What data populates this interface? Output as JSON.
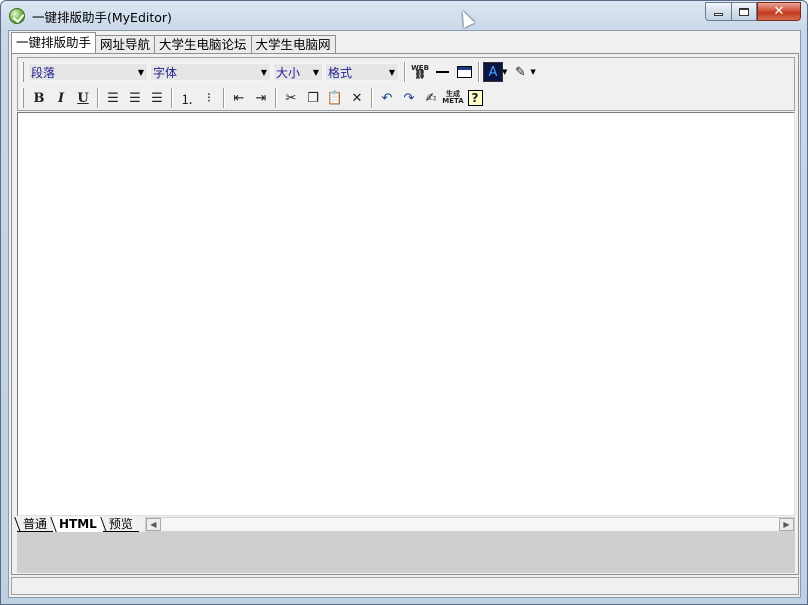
{
  "window": {
    "title": "一键排版助手(MyEditor)",
    "close_color": "#c13920"
  },
  "tabs": [
    {
      "label": "一键排版助手",
      "active": true
    },
    {
      "label": "网址导航",
      "active": false
    },
    {
      "label": "大学生电脑论坛",
      "active": false
    },
    {
      "label": "大学生电脑网",
      "active": false
    }
  ],
  "toolbar": {
    "paragraph_combo": "段落",
    "font_combo": "字体",
    "size_combo": "大小",
    "style_combo": "格式",
    "web_icon_label": "WEB",
    "bold_label": "B",
    "italic_label": "I",
    "underline_label": "U",
    "meta_label": "生成 META"
  },
  "mode_tabs": [
    {
      "label": "普通",
      "active": false
    },
    {
      "label": "HTML",
      "active": true
    },
    {
      "label": "预览",
      "active": false
    }
  ]
}
